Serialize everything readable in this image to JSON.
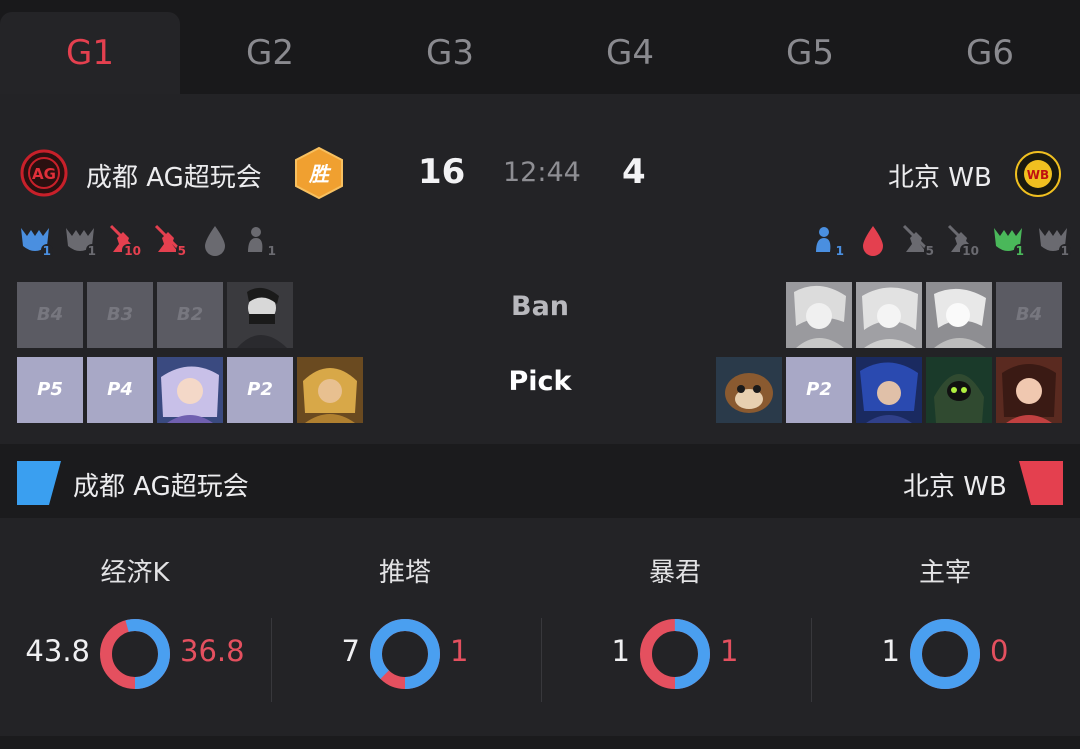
{
  "tabs": [
    "G1",
    "G2",
    "G3",
    "G4",
    "G5",
    "G6"
  ],
  "active_tab": 0,
  "match": {
    "left_team": "成都 AG超玩会",
    "right_team": "北京 WB",
    "left_score": "16",
    "right_score": "4",
    "time": "12:44",
    "win_badge": "胜",
    "left_logo_text": "AG",
    "right_logo_text": "WB"
  },
  "objectives": {
    "left": [
      {
        "icon": "dragon-icon",
        "count": "1",
        "color": "#4a8fe0"
      },
      {
        "icon": "dragon-icon",
        "count": "1",
        "color": "#6a6a70"
      },
      {
        "icon": "tower-icon",
        "count": "10",
        "color": "#e4404f"
      },
      {
        "icon": "tower-icon",
        "count": "5",
        "color": "#e4404f"
      },
      {
        "icon": "blood-icon",
        "count": "",
        "color": "#6a6a70"
      },
      {
        "icon": "tyrant-icon",
        "count": "1",
        "color": "#6a6a70"
      }
    ],
    "right": [
      {
        "icon": "tyrant-icon",
        "count": "1",
        "color": "#4a8fe0"
      },
      {
        "icon": "blood-icon",
        "count": "",
        "color": "#e4404f"
      },
      {
        "icon": "tower-icon",
        "count": "5",
        "color": "#6a6a70"
      },
      {
        "icon": "tower-icon",
        "count": "10",
        "color": "#6a6a70"
      },
      {
        "icon": "dragon-icon",
        "count": "1",
        "color": "#4ab85a"
      },
      {
        "icon": "dragon-icon",
        "count": "1",
        "color": "#6a6a70"
      }
    ]
  },
  "ban_label": "Ban",
  "pick_label": "Pick",
  "left_bans": [
    "B4",
    "B3",
    "B2",
    "hero"
  ],
  "right_bans": [
    "hero",
    "hero",
    "hero",
    "B4"
  ],
  "left_picks": [
    "P5",
    "P4",
    "hero",
    "P2",
    "hero"
  ],
  "right_picks": [
    "hero",
    "P2",
    "hero",
    "hero",
    "hero"
  ],
  "strip": {
    "left": "成都 AG超玩会",
    "right": "北京 WB",
    "left_color": "#3a9ff0",
    "right_color": "#e4404f"
  },
  "stats": [
    {
      "title": "经济K",
      "left": "43.8",
      "right": "36.8",
      "left_value": 43.8,
      "right_value": 36.8
    },
    {
      "title": "推塔",
      "left": "7",
      "right": "1",
      "left_value": 7,
      "right_value": 1
    },
    {
      "title": "暴君",
      "left": "1",
      "right": "1",
      "left_value": 1,
      "right_value": 1
    },
    {
      "title": "主宰",
      "left": "1",
      "right": "0",
      "left_value": 1,
      "right_value": 0
    }
  ],
  "colors": {
    "accent_red": "#e4404f",
    "accent_blue": "#4a9ff0",
    "background": "#232326"
  }
}
